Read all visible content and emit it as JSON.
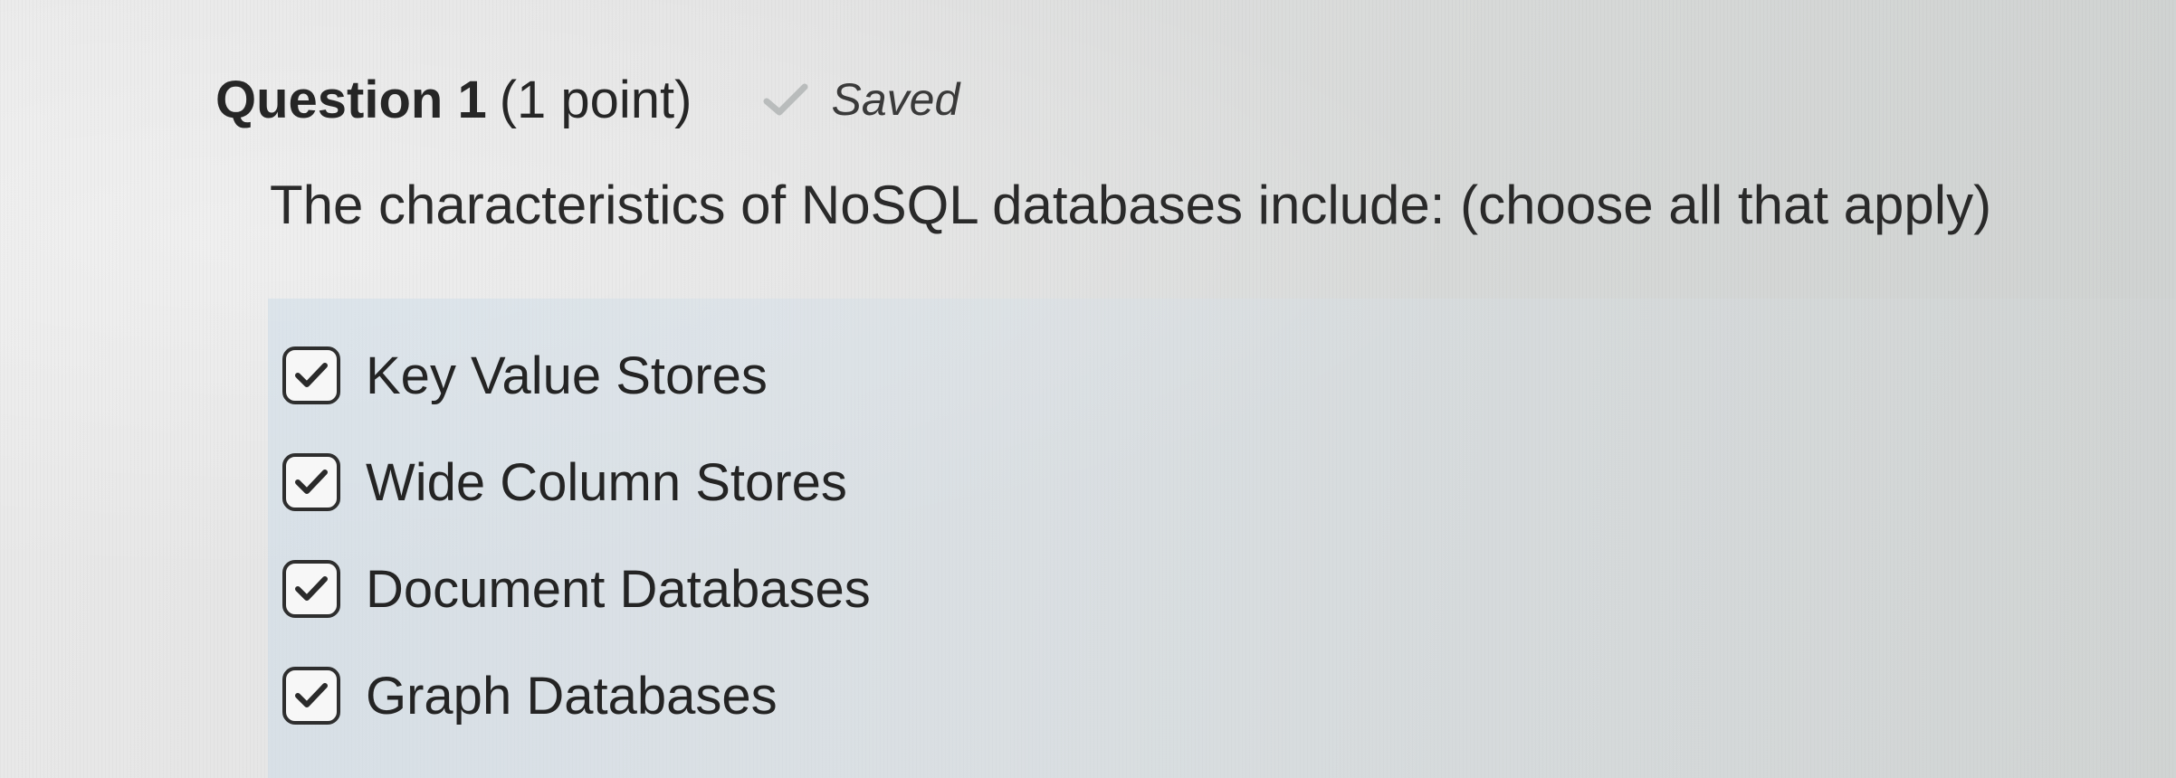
{
  "question": {
    "title": "Question 1",
    "points": "(1 point)",
    "save_status": "Saved",
    "prompt": "The characteristics of NoSQL databases include: (choose all that apply)"
  },
  "options": [
    {
      "label": "Key Value Stores",
      "checked": true
    },
    {
      "label": "Wide Column Stores",
      "checked": true
    },
    {
      "label": "Document Databases",
      "checked": true
    },
    {
      "label": "Graph Databases",
      "checked": true
    }
  ],
  "icons": {
    "saved": "checkmark-icon",
    "checkbox": "checkmark-icon"
  },
  "colors": {
    "text": "#262626",
    "saved_check": "#b9bcbc",
    "answer_highlight": "#cddce8"
  }
}
